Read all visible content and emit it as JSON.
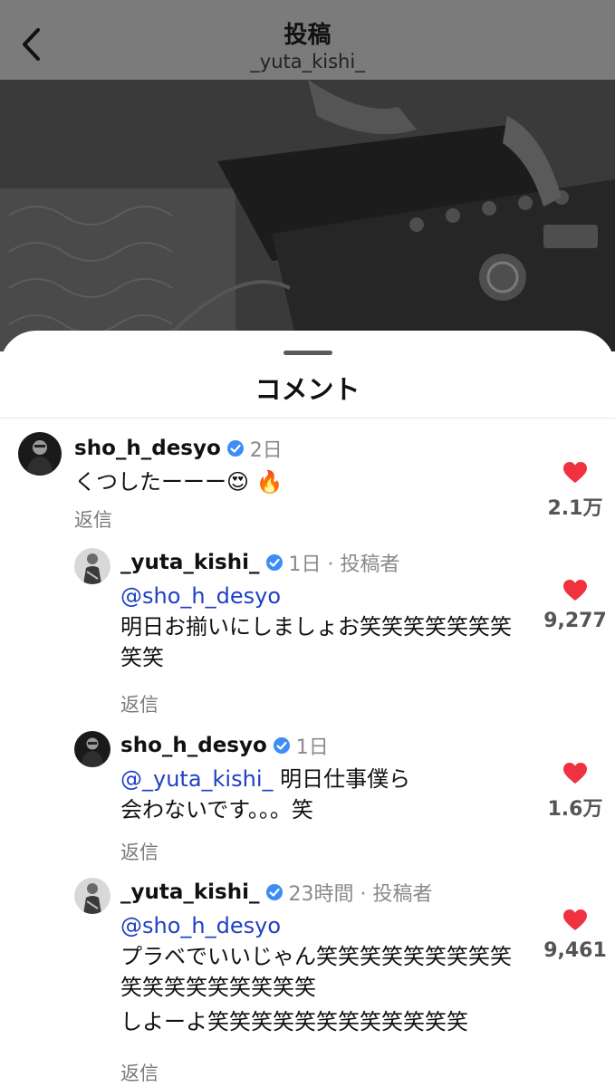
{
  "header": {
    "title": "投稿",
    "subtitle": "_yuta_kishi_"
  },
  "sheet": {
    "title": "コメント"
  },
  "comments": [
    {
      "username": "sho_h_desyo",
      "time": "2日",
      "text": "くつしたーーー😍 🔥",
      "reply": "返信",
      "likes": "2.1万"
    },
    {
      "username": "_yuta_kishi_",
      "time": "1日 · 投稿者",
      "mention": "@sho_h_desyo",
      "text": "明日お揃いにしましょお笑笑笑笑笑笑笑笑笑",
      "reply": "返信",
      "likes": "9,277"
    },
    {
      "username": "sho_h_desyo",
      "time": "1日",
      "mention": "@_yuta_kishi_",
      "text": " 明日仕事僕ら会わないです。。。笑",
      "reply": "返信",
      "likes": "1.6万"
    },
    {
      "username": "_yuta_kishi_",
      "time": "23時間 · 投稿者",
      "mention": "@sho_h_desyo",
      "text_line1": "プラベでいいじゃん笑笑笑笑笑笑笑笑笑笑笑笑笑笑笑笑笑笑",
      "text_line2": "しよーよ笑笑笑笑笑笑笑笑笑笑笑笑",
      "reply": "返信",
      "likes": "9,461"
    }
  ],
  "colors": {
    "like": "#f0313f",
    "verified": "#3d8df5",
    "mention": "#1f3fc4",
    "header_bg": "#7b7b7b"
  },
  "icons": {
    "back": "chevron-left-icon",
    "verified": "verified-badge-icon",
    "like": "heart-icon"
  }
}
